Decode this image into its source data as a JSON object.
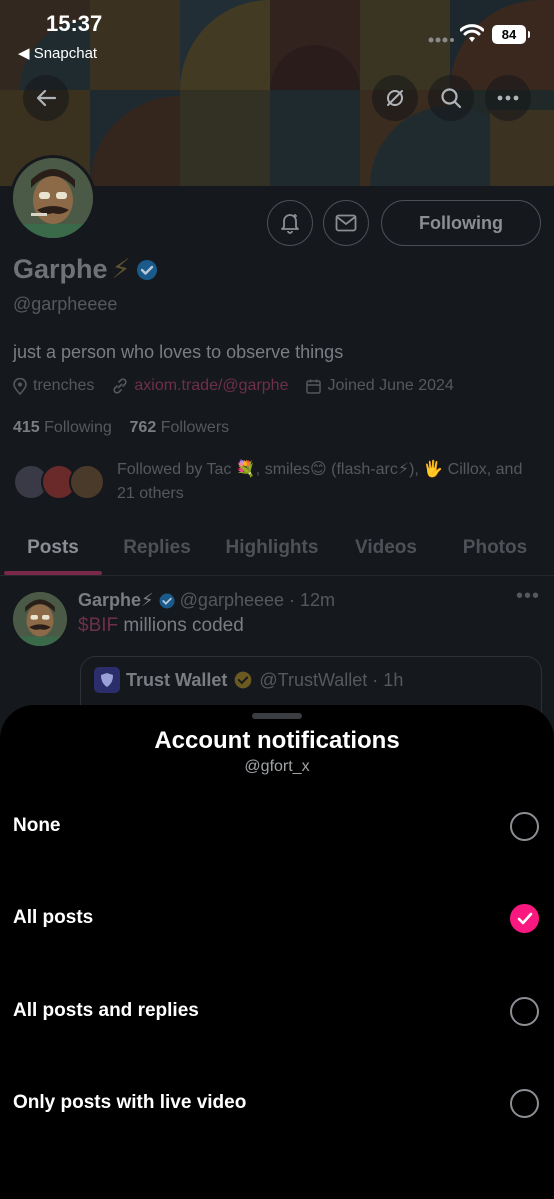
{
  "status_bar": {
    "time": "15:37",
    "back_app": "◀ Snapchat",
    "battery": "84"
  },
  "profile": {
    "name": "Garphe",
    "name_emoji": "⚡",
    "handle": "@garpheeee",
    "bio": "just a person who loves to observe things",
    "location": "trenches",
    "link": "axiom.trade/@garphe",
    "joined": "Joined June 2024",
    "following_count": "415",
    "following_label": "Following",
    "followers_count": "762",
    "followers_label": "Followers",
    "followed_by": "Followed by Tac 💐, smiles😊 (flash-arc⚡), 🖐 Cillox, and 21 others",
    "following_button": "Following"
  },
  "tabs": [
    {
      "label": "Posts",
      "active": true
    },
    {
      "label": "Replies",
      "active": false
    },
    {
      "label": "Highlights",
      "active": false
    },
    {
      "label": "Videos",
      "active": false
    },
    {
      "label": "Photos",
      "active": false
    }
  ],
  "post": {
    "author": "Garphe⚡",
    "handle_time": "@garpheeee · 12m",
    "cashtag": "$BIF",
    "text": " millions coded",
    "quote_author": "Trust Wallet",
    "quote_handle_time": "@TrustWallet · 1h"
  },
  "sheet": {
    "title": "Account notifications",
    "subtitle": "@gfort_x",
    "options": [
      {
        "label": "None",
        "selected": false
      },
      {
        "label": "All posts",
        "selected": true
      },
      {
        "label": "All posts and replies",
        "selected": false
      },
      {
        "label": "Only posts with live video",
        "selected": false
      }
    ]
  },
  "colors": {
    "accent": "#f91880",
    "verified": "#1d9bf0",
    "sheet_bg": "#000000"
  }
}
